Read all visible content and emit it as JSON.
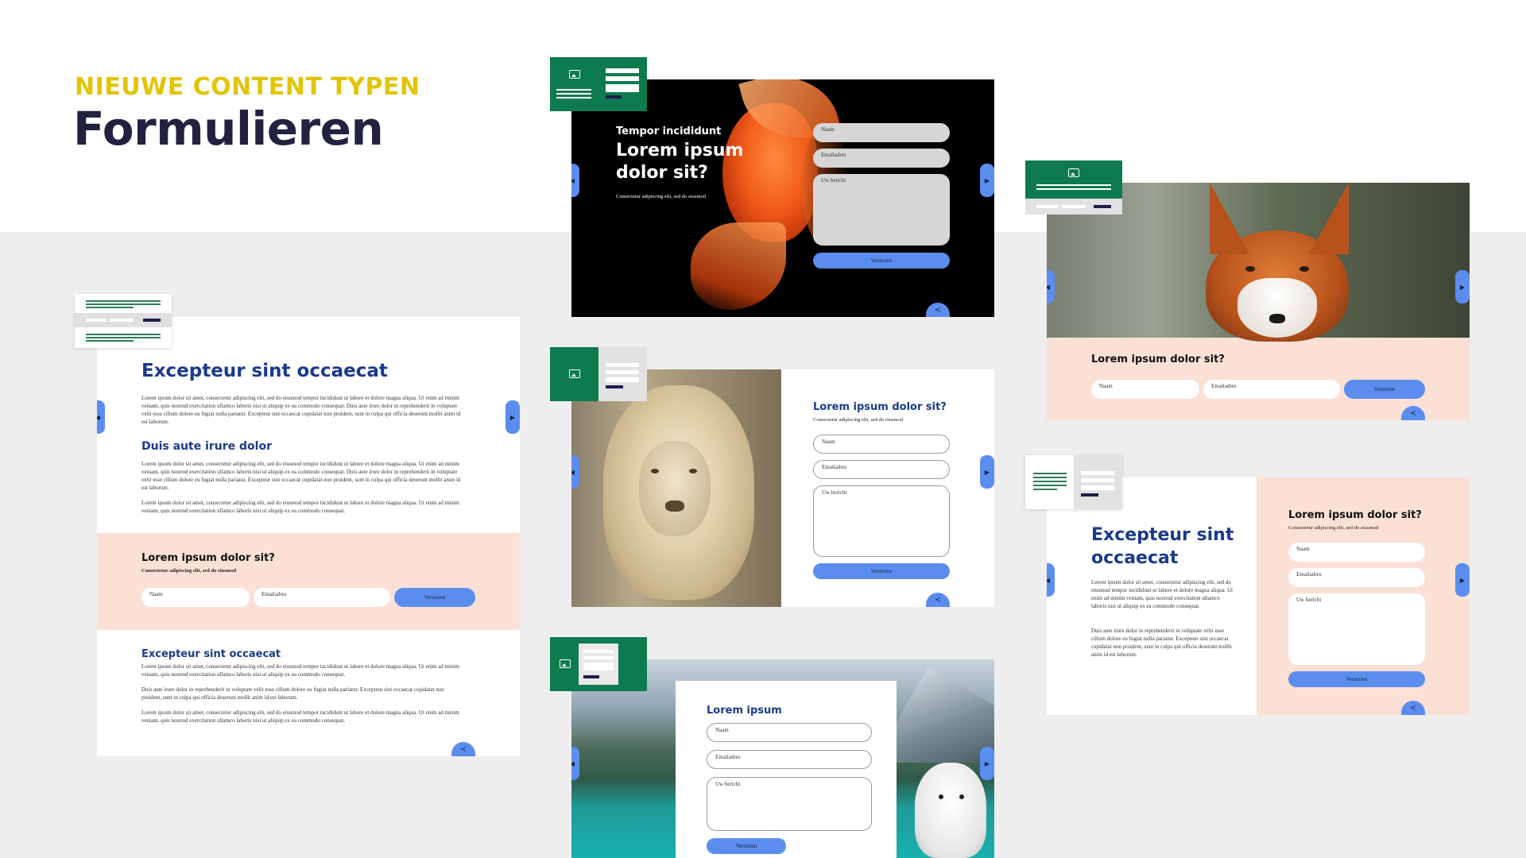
{
  "header": {
    "kicker": "NIEUWE CONTENT TYPEN",
    "title": "Formulieren"
  },
  "form": {
    "naam": "Naam",
    "email": "Emailadres",
    "bericht": "Uw bericht",
    "submit": "Versturen"
  },
  "colors": {
    "green": "#0d7a4f",
    "blue": "#5b8def",
    "navy": "#1a3a8a",
    "peach": "#fbe0d6"
  },
  "goldfish": {
    "kicker": "Tempor incididunt",
    "heading": "Lorem ipsum dolor sit?",
    "sub": "Consectetur adipiscing elit, sed do eiusmod"
  },
  "article": {
    "heading": "Excepteur sint occaecat",
    "para1": "Lorem ipsum dolor sit amet, consectetur adipiscing elit, sed do eiusmod tempor incididunt ut labore et dolore magna aliqua. Ut enim ad minim veniam, quis nostrud exercitation ullamco laboris nisi ut aliquip ex ea commodo consequat. Duis aute irure dolor in reprehenderit in voluptate velit esse cillum dolore eu fugiat nulla pariatur. Excepteur sint occaecat cupidatat non proident, sunt in culpa qui officia deserunt mollit anim id est laborum.",
    "subheading": "Duis aute irure dolor",
    "para2": "Lorem ipsum dolor sit amet, consectetur adipiscing elit, sed do eiusmod tempor incididunt ut labore et dolore magna aliqua. Ut enim ad minim veniam, quis nostrud exercitation ullamco laboris nisi ut aliquip ex ea commodo consequat. Duis aute irure dolor in reprehenderit in voluptate velit esse cillum dolore eu fugiat nulla pariatur. Excepteur sint occaecat cupidatat non proident, sunt in culpa qui officia deserunt mollit anim id est laborum.",
    "para3": "Lorem ipsum dolor sit amet, consectetur adipiscing elit, sed do eiusmod tempor incididunt ut labore et dolore magna aliqua. Ut enim ad minim veniam, quis nostrud exercitation ullamco laboris nisi ut aliquip ex ea commodo consequat.",
    "form_heading": "Lorem ipsum dolor sit?",
    "form_sub": "Consectetur adipiscing elit, sed do eiusmod",
    "heading2": "Excepteur sint occaecat",
    "para4": "Lorem ipsum dolor sit amet, consectetur adipiscing elit, sed do eiusmod tempor incididunt ut labore et dolore magna aliqua. Ut enim ad minim veniam, quis nostrud exercitation ullamco laboris nisi ut aliquip ex ea commodo consequat.",
    "para5": "Duis aute irure dolor in reprehenderit in voluptate velit esse cillum dolore eu fugiat nulla pariatur. Excepteur sint occaecat cupidatat non proident, sunt in culpa qui officia deserunt mollit anim id est laborum.",
    "para6": "Lorem ipsum dolor sit amet, consectetur adipiscing elit, sed do eiusmod tempor incididunt ut labore et dolore magna aliqua. Ut enim ad minim veniam, quis nostrud exercitation ullamco laboris nisi ut aliquip ex ea commodo consequat."
  },
  "lion": {
    "heading": "Lorem ipsum dolor sit?",
    "sub": "Consectetur adipiscing elit, sed do eiusmod"
  },
  "lake": {
    "heading": "Lorem ipsum"
  },
  "fox": {
    "heading": "Lorem ipsum dolor sit?"
  },
  "split": {
    "heading": "Excepteur sint occaecat",
    "para1": "Lorem ipsum dolor sit amet, consectetur adipiscing elit, sed do eiusmod tempor incididunt ut labore et dolore magna aliqua. Ut enim ad minim veniam, quis nostrud exercitation ullamco laboris nisi ut aliquip ex ea commodo consequat.",
    "para2": "Duis aute irure dolor in reprehenderit in voluptate velit esse cillum dolore eu fugiat nulla pariatur. Excepteur sint occaecat cupidatat non proident, sunt in culpa qui officia deserunt mollit anim id est laborum.",
    "form_heading": "Lorem ipsum dolor sit?",
    "form_sub": "Consectetur adipiscing elit, sed do eiusmod"
  }
}
